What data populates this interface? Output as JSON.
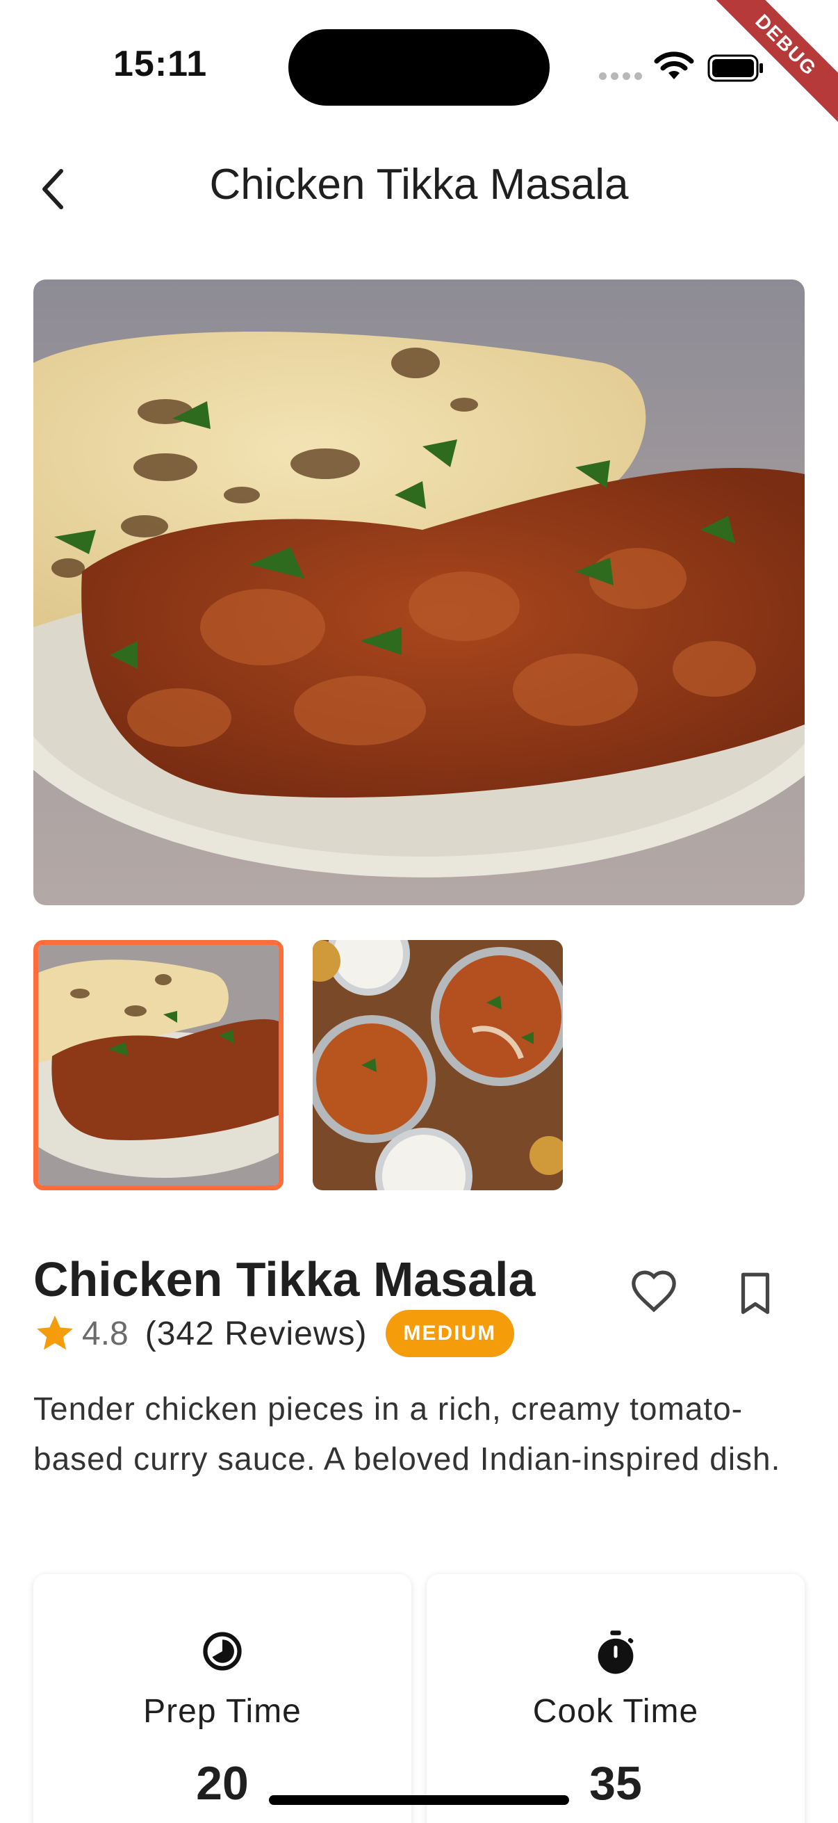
{
  "status_bar": {
    "time": "15:11",
    "debug_label": "DEBUG"
  },
  "header": {
    "title": "Chicken Tikka Masala",
    "back_icon": "chevron-left-icon"
  },
  "gallery": {
    "images": [
      {
        "name": "chicken tikka masala with naan",
        "selected": true
      },
      {
        "name": "curry bowls with rice",
        "selected": false
      }
    ],
    "selected_border_color": "#ff6e3a"
  },
  "recipe": {
    "title": "Chicken Tikka Masala",
    "rating": "4.8",
    "reviews": "(342 Reviews)",
    "difficulty": "MEDIUM",
    "difficulty_color": "#f59c0b",
    "description": "Tender chicken pieces in a rich, creamy tomato-based curry sauce. A beloved Indian-inspired dish."
  },
  "times": {
    "prep": {
      "label": "Prep Time",
      "value": "20",
      "icon": "timer-pie-icon"
    },
    "cook": {
      "label": "Cook Time",
      "value": "35",
      "icon": "stopwatch-icon"
    }
  },
  "colors": {
    "accent": "#ff6e3a",
    "star": "#f59c0b"
  }
}
